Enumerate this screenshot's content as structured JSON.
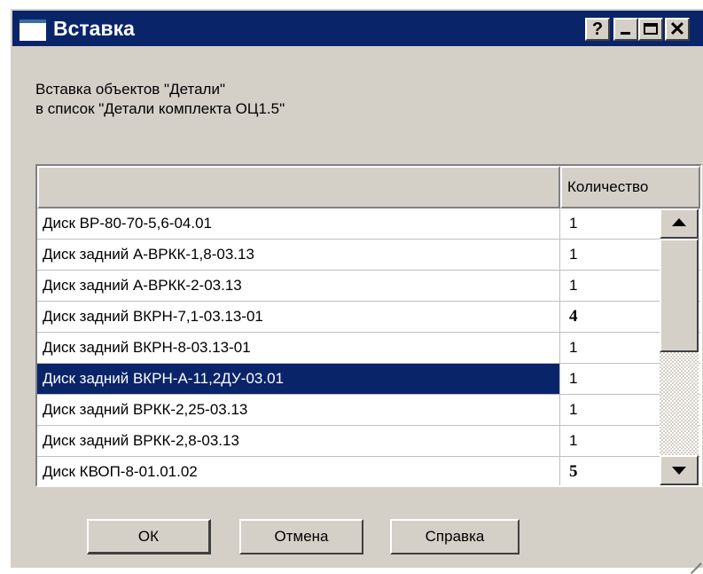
{
  "window": {
    "title": "Вставка",
    "help_glyph": "?",
    "close_glyph": "✕"
  },
  "info": {
    "line1": "Вставка объектов \"Детали\"",
    "line2": "в список \"Детали комплекта ОЦ1.5\""
  },
  "table": {
    "columns": [
      "",
      "Количество"
    ],
    "rows": [
      {
        "name": "Диск ВР-80-70-5,6-04.01",
        "qty": "1",
        "bold": false,
        "selected": false
      },
      {
        "name": "Диск задний А-ВРКК-1,8-03.13",
        "qty": "1",
        "bold": false,
        "selected": false
      },
      {
        "name": "Диск задний А-ВРКК-2-03.13",
        "qty": "1",
        "bold": false,
        "selected": false
      },
      {
        "name": "Диск задний ВКРН-7,1-03.13-01",
        "qty": "4",
        "bold": true,
        "selected": false
      },
      {
        "name": "Диск задний ВКРН-8-03.13-01",
        "qty": "1",
        "bold": false,
        "selected": false
      },
      {
        "name": "Диск задний ВКРН-А-11,2ДУ-03.01",
        "qty": "1",
        "bold": false,
        "selected": true
      },
      {
        "name": "Диск задний ВРКК-2,25-03.13",
        "qty": "1",
        "bold": false,
        "selected": false
      },
      {
        "name": "Диск задний ВРКК-2,8-03.13",
        "qty": "1",
        "bold": false,
        "selected": false
      },
      {
        "name": "Диск КВОП-8-01.01.02",
        "qty": "5",
        "bold": true,
        "selected": false
      }
    ]
  },
  "buttons": {
    "ok": "ОК",
    "cancel": "Отмена",
    "help": "Справка"
  },
  "colors": {
    "titlebar": "#0a246a",
    "face": "#d4d0c8",
    "selection": "#0a246a"
  }
}
